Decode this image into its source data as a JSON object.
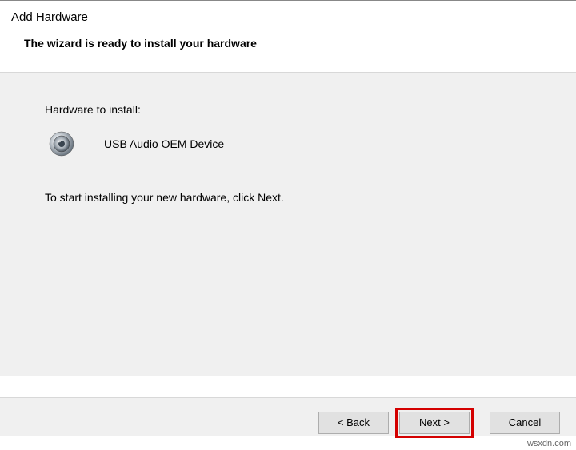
{
  "header": {
    "title": "Add Hardware",
    "subtitle": "The wizard is ready to install your hardware"
  },
  "content": {
    "label_install": "Hardware to install:",
    "device_name": "USB Audio OEM Device",
    "instruction": "To start installing your new hardware, click Next."
  },
  "footer": {
    "back": "< Back",
    "next": "Next >",
    "cancel": "Cancel"
  },
  "watermark": "wsxdn.com"
}
